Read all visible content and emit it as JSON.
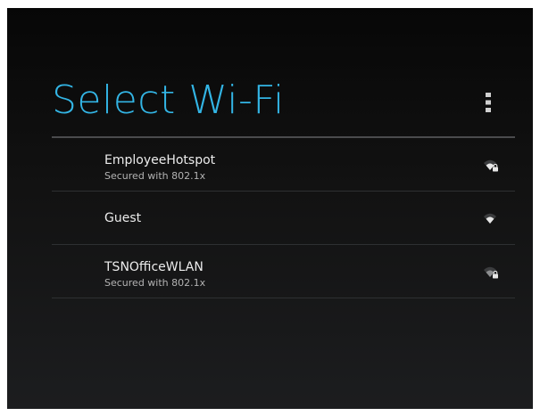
{
  "header": {
    "title": "Select Wi-Fi",
    "overflow_icon": "overflow-menu-icon"
  },
  "colors": {
    "accent": "#33b5e5",
    "primary_text": "#ececec",
    "secondary_text": "#b3b3b3"
  },
  "networks": [
    {
      "ssid": "EmployeeHotspot",
      "security": "Secured with 802.1x",
      "signal_icon": "wifi-lock-icon"
    },
    {
      "ssid": "Guest",
      "security": "",
      "signal_icon": "wifi-icon"
    },
    {
      "ssid": "TSNOfficeWLAN",
      "security": "Secured with 802.1x",
      "signal_icon": "wifi-lock-icon"
    }
  ]
}
